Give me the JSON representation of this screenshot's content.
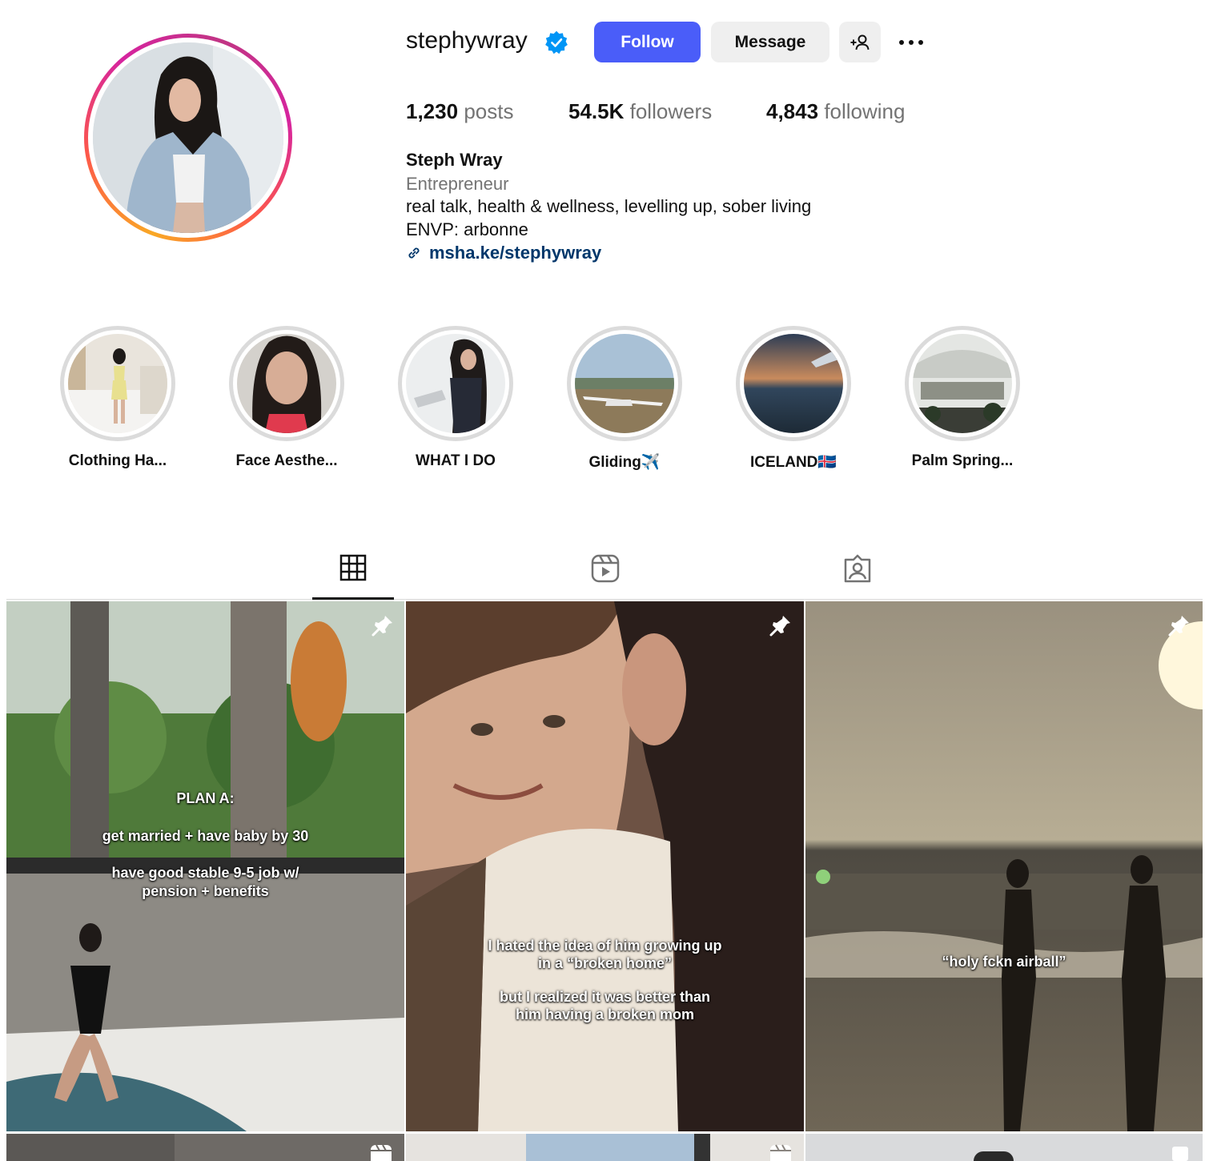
{
  "profile": {
    "username": "stephywray",
    "verified": true,
    "follow_label": "Follow",
    "message_label": "Message",
    "stats": {
      "posts_count": "1,230",
      "posts_label": "posts",
      "followers_count": "54.5K",
      "followers_label": "followers",
      "following_count": "4,843",
      "following_label": "following"
    },
    "full_name": "Steph Wray",
    "category": "Entrepreneur",
    "bio_lines": [
      "real talk, health & wellness, levelling up, sober living",
      "ENVP: arbonne"
    ],
    "link": "msha.ke/stephywray"
  },
  "highlights": [
    {
      "label": "Clothing Ha..."
    },
    {
      "label": "Face Aesthe..."
    },
    {
      "label": "WHAT I DO"
    },
    {
      "label": "Gliding✈️"
    },
    {
      "label": "ICELAND🇮🇸"
    },
    {
      "label": "Palm Spring..."
    }
  ],
  "tabs": [
    {
      "icon": "grid-icon",
      "active": true
    },
    {
      "icon": "reels-icon",
      "active": false
    },
    {
      "icon": "tagged-icon",
      "active": false
    }
  ],
  "posts": [
    {
      "overlay": [
        "PLAN A:",
        "",
        "get married + have baby by 30",
        "",
        "have good stable 9-5 job w/",
        "pension + benefits"
      ],
      "pinned": true
    },
    {
      "overlay": [
        "I hated the idea of him growing up",
        "in a “broken home”",
        "",
        "but I realized it was better than",
        "him having a broken mom"
      ],
      "pinned": true
    },
    {
      "overlay": [
        "“holy fckn airball”"
      ],
      "pinned": true
    }
  ],
  "colors": {
    "follow_button": "#4a5df9",
    "link": "#00376b",
    "verified": "#0095f6",
    "muted_text": "#737373"
  }
}
